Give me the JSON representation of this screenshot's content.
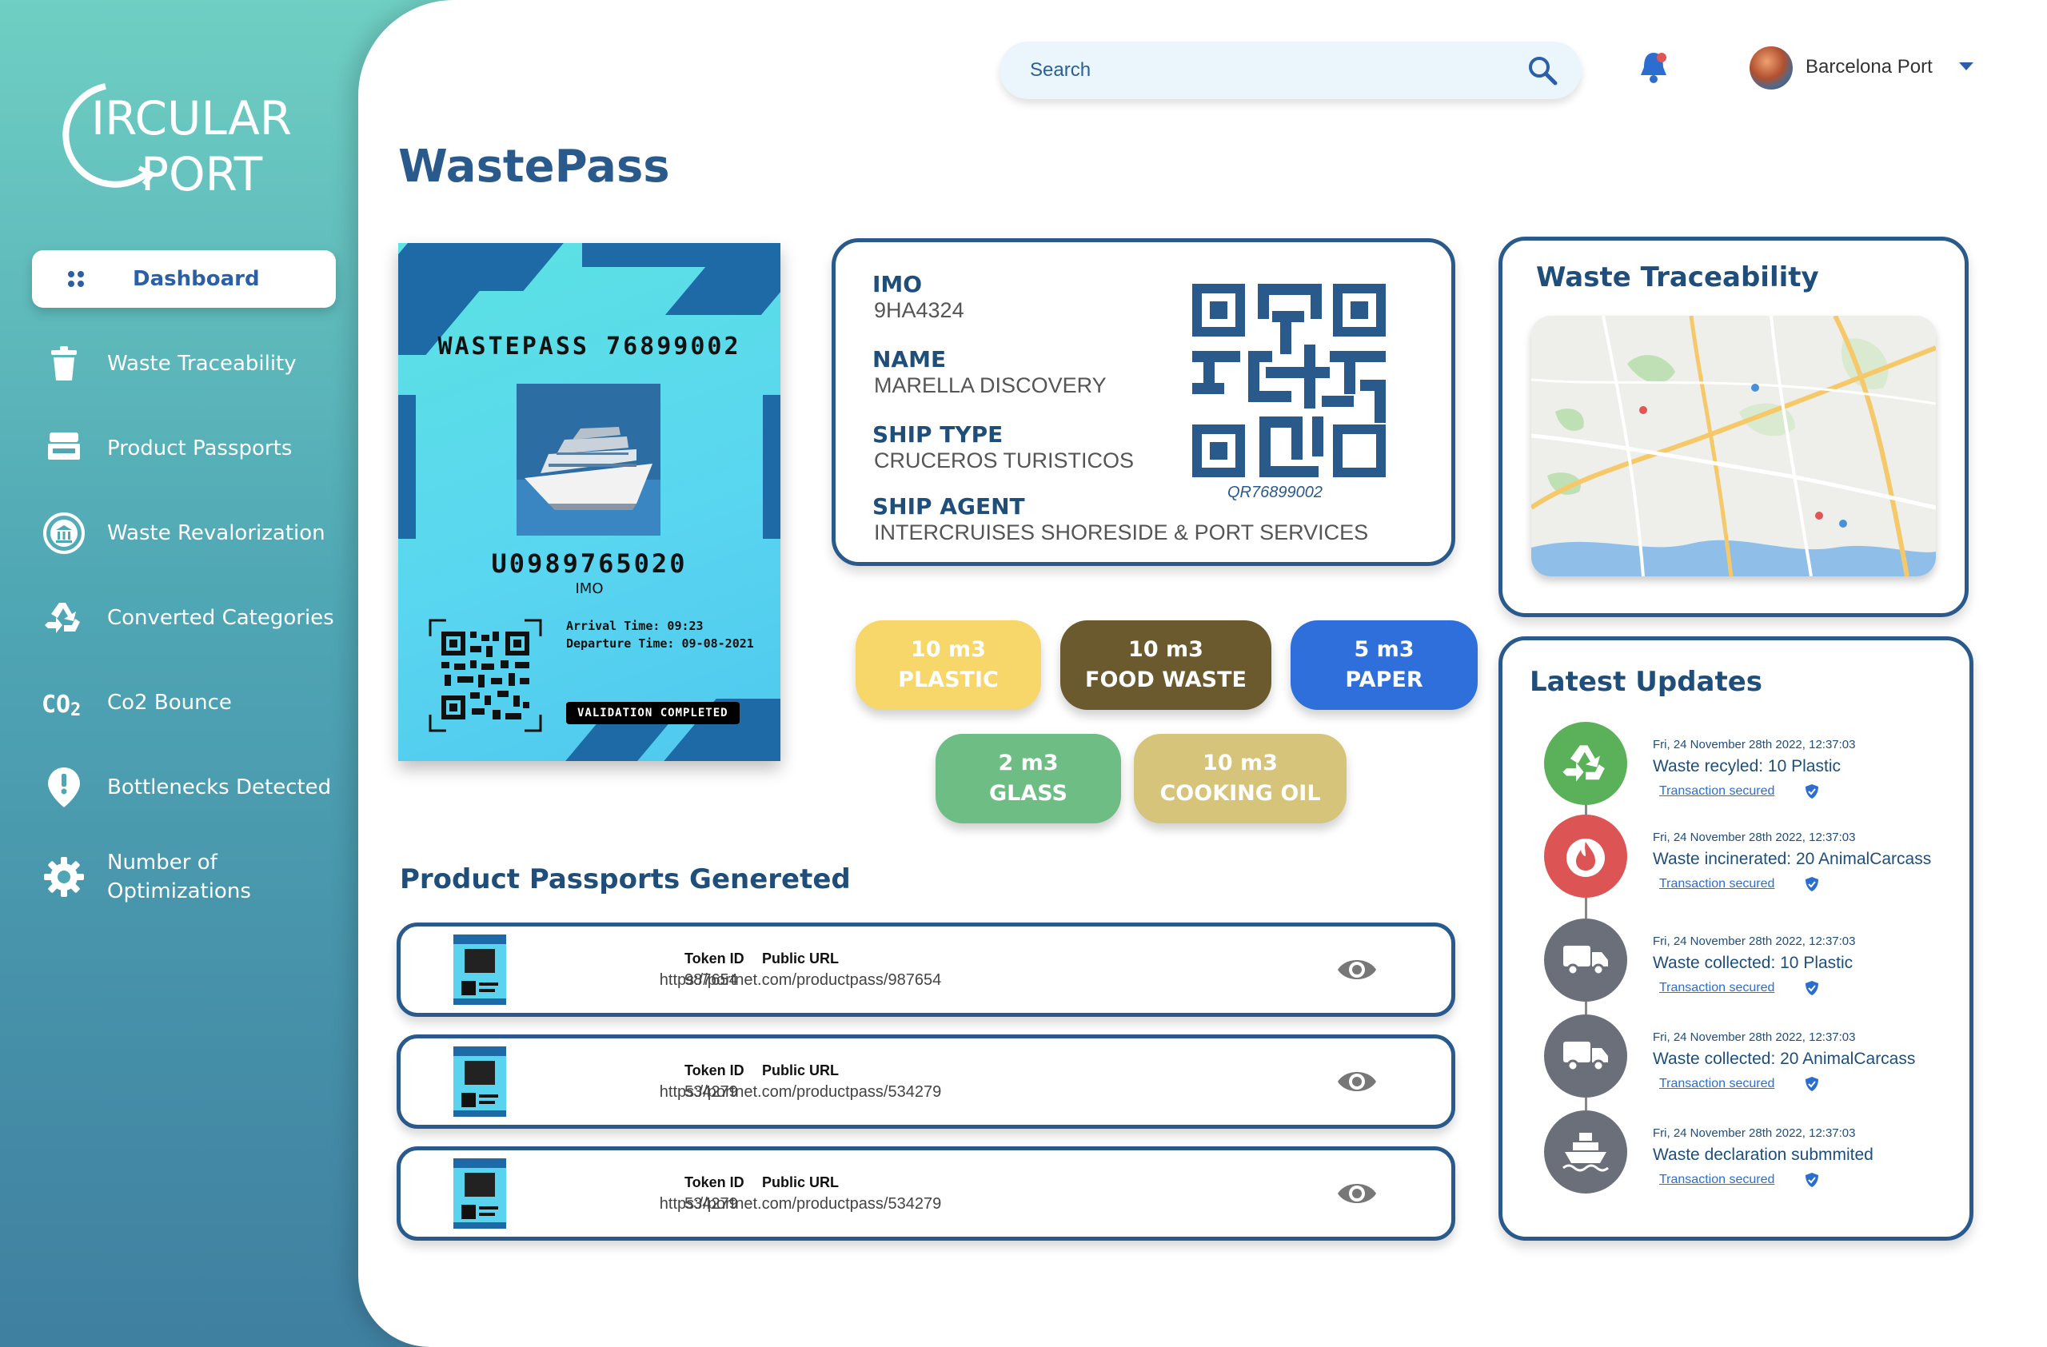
{
  "brand": {
    "line1": "IRCULAR",
    "line2": "PORT"
  },
  "sidebar": {
    "items": [
      {
        "label": "Dashboard",
        "icon": "grid-icon"
      },
      {
        "label": "Waste Traceability",
        "icon": "trash-icon"
      },
      {
        "label": "Product Passports",
        "icon": "passport-icon"
      },
      {
        "label": "Waste Revalorization",
        "icon": "bank-icon"
      },
      {
        "label": "Converted Categories",
        "icon": "recycle-icon"
      },
      {
        "label": "Co2 Bounce",
        "icon": "co2-icon"
      },
      {
        "label": "Bottlenecks Detected",
        "icon": "alert-pin-icon"
      },
      {
        "label": "Number of Optimizations",
        "icon": "gear-icon"
      }
    ]
  },
  "header": {
    "search_placeholder": "Search",
    "user_name": "Barcelona Port"
  },
  "page": {
    "title": "WastePass"
  },
  "wastepass": {
    "title": "WASTEPASS 76899002",
    "ship_id": "U0989765020",
    "id_label": "IMO",
    "arrival": "Arrival Time: 09:23",
    "departure": "Departure Time: 09-08-2021",
    "badge": "VALIDATION COMPLETED"
  },
  "ship_info": {
    "imo_label": "IMO",
    "imo": "9HA4324",
    "name_label": "NAME",
    "name": "MARELLA DISCOVERY",
    "type_label": "SHIP TYPE",
    "type": "CRUCEROS TURISTICOS",
    "agent_label": "SHIP AGENT",
    "agent": "INTERCRUISES SHORESIDE & PORT SERVICES",
    "qr_code": "QR76899002"
  },
  "waste": [
    {
      "amount": "10 m3",
      "type": "PLASTIC",
      "color": "#f7d66a"
    },
    {
      "amount": "10 m3",
      "type": "FOOD WASTE",
      "color": "#6b5a2e"
    },
    {
      "amount": "5 m3",
      "type": "PAPER",
      "color": "#2f6fdc"
    },
    {
      "amount": "2 m3",
      "type": "GLASS",
      "color": "#6dbd84"
    },
    {
      "amount": "10 m3",
      "type": "COOKING OIL",
      "color": "#d6c47a"
    }
  ],
  "passports": {
    "title": "Product Passports Genereted",
    "token_label": "Token ID",
    "url_label": "Public URL",
    "rows": [
      {
        "token": "987654",
        "url": "https://portnet.com/productpass/987654"
      },
      {
        "token": "534279",
        "url": "https://portnet.com/productpass/534279"
      },
      {
        "token": "534279",
        "url": "https://portnet.com/productpass/534279"
      }
    ]
  },
  "traceability": {
    "title": "Waste Traceability"
  },
  "updates": {
    "title": "Latest Updates",
    "items": [
      {
        "time": "Fri, 24 November 28th 2022, 12:37:03",
        "text": "Waste recyled: 10 Plastic",
        "secured": "Transaction secured",
        "icon": "recycle-icon",
        "color": "#5bb05a"
      },
      {
        "time": "Fri, 24 November 28th 2022, 12:37:03",
        "text": "Waste incinerated: 20 AnimalCarcass",
        "secured": "Transaction secured",
        "icon": "fire-icon",
        "color": "#dd5454"
      },
      {
        "time": "Fri, 24 November 28th 2022, 12:37:03",
        "text": "Waste collected: 10 Plastic",
        "secured": "Transaction secured",
        "icon": "truck-icon",
        "color": "#6b6f7a"
      },
      {
        "time": "Fri, 24 November 28th 2022, 12:37:03",
        "text": "Waste collected: 20 AnimalCarcass",
        "secured": "Transaction secured",
        "icon": "truck-icon",
        "color": "#6b6f7a"
      },
      {
        "time": "Fri, 24 November 28th 2022, 12:37:03",
        "text": "Waste declaration submmited",
        "secured": "Transaction secured",
        "icon": "ship-icon",
        "color": "#6b6f7a"
      }
    ]
  }
}
